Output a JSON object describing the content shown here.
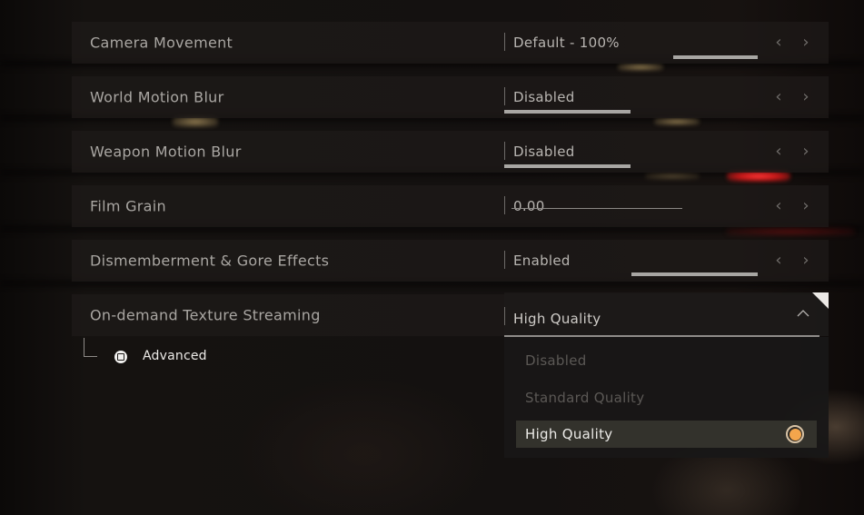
{
  "settings": [
    {
      "label": "Camera Movement",
      "value": "Default - 100%",
      "indicator": {
        "type": "bar",
        "fill_fraction": 1.0
      }
    },
    {
      "label": "World Motion Blur",
      "value": "Disabled",
      "indicator": {
        "type": "bar",
        "fill_fraction": 1.0
      }
    },
    {
      "label": "Weapon Motion Blur",
      "value": "Disabled",
      "indicator": {
        "type": "bar",
        "fill_fraction": 1.0
      }
    },
    {
      "label": "Film Grain",
      "value": "0.00",
      "indicator": {
        "type": "slider",
        "fill_fraction": 0.0
      }
    },
    {
      "label": "Dismemberment & Gore Effects",
      "value": "Enabled",
      "indicator": {
        "type": "bar",
        "fill_fraction": 1.0
      }
    }
  ],
  "arrows": {
    "prev_icon": "chevron-left-icon",
    "next_icon": "chevron-right-icon",
    "prev": "‹",
    "next": "›"
  },
  "texture_streaming": {
    "label": "On-demand Texture Streaming",
    "selected": "High Quality",
    "caret_icon": "chevron-up-icon",
    "options": [
      {
        "label": "Disabled",
        "state": "disabled"
      },
      {
        "label": "Standard Quality",
        "state": "disabled"
      },
      {
        "label": "High Quality",
        "state": "selected"
      }
    ]
  },
  "advanced": {
    "label": "Advanced",
    "icon": "square-button-icon"
  },
  "colors": {
    "accent": "#f3a54c",
    "text_label": "#a9a6a2",
    "text_active": "#ecebe8"
  }
}
